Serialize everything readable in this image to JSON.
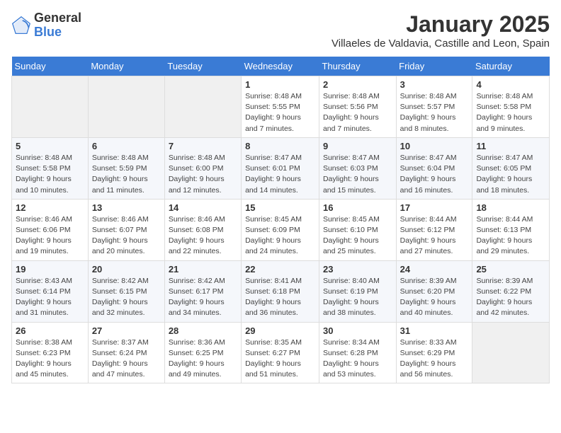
{
  "header": {
    "logo_general": "General",
    "logo_blue": "Blue",
    "month": "January 2025",
    "location": "Villaeles de Valdavia, Castille and Leon, Spain"
  },
  "weekdays": [
    "Sunday",
    "Monday",
    "Tuesday",
    "Wednesday",
    "Thursday",
    "Friday",
    "Saturday"
  ],
  "weeks": [
    [
      {
        "day": "",
        "info": ""
      },
      {
        "day": "",
        "info": ""
      },
      {
        "day": "",
        "info": ""
      },
      {
        "day": "1",
        "info": "Sunrise: 8:48 AM\nSunset: 5:55 PM\nDaylight: 9 hours and 7 minutes."
      },
      {
        "day": "2",
        "info": "Sunrise: 8:48 AM\nSunset: 5:56 PM\nDaylight: 9 hours and 7 minutes."
      },
      {
        "day": "3",
        "info": "Sunrise: 8:48 AM\nSunset: 5:57 PM\nDaylight: 9 hours and 8 minutes."
      },
      {
        "day": "4",
        "info": "Sunrise: 8:48 AM\nSunset: 5:58 PM\nDaylight: 9 hours and 9 minutes."
      }
    ],
    [
      {
        "day": "5",
        "info": "Sunrise: 8:48 AM\nSunset: 5:58 PM\nDaylight: 9 hours and 10 minutes."
      },
      {
        "day": "6",
        "info": "Sunrise: 8:48 AM\nSunset: 5:59 PM\nDaylight: 9 hours and 11 minutes."
      },
      {
        "day": "7",
        "info": "Sunrise: 8:48 AM\nSunset: 6:00 PM\nDaylight: 9 hours and 12 minutes."
      },
      {
        "day": "8",
        "info": "Sunrise: 8:47 AM\nSunset: 6:01 PM\nDaylight: 9 hours and 14 minutes."
      },
      {
        "day": "9",
        "info": "Sunrise: 8:47 AM\nSunset: 6:03 PM\nDaylight: 9 hours and 15 minutes."
      },
      {
        "day": "10",
        "info": "Sunrise: 8:47 AM\nSunset: 6:04 PM\nDaylight: 9 hours and 16 minutes."
      },
      {
        "day": "11",
        "info": "Sunrise: 8:47 AM\nSunset: 6:05 PM\nDaylight: 9 hours and 18 minutes."
      }
    ],
    [
      {
        "day": "12",
        "info": "Sunrise: 8:46 AM\nSunset: 6:06 PM\nDaylight: 9 hours and 19 minutes."
      },
      {
        "day": "13",
        "info": "Sunrise: 8:46 AM\nSunset: 6:07 PM\nDaylight: 9 hours and 20 minutes."
      },
      {
        "day": "14",
        "info": "Sunrise: 8:46 AM\nSunset: 6:08 PM\nDaylight: 9 hours and 22 minutes."
      },
      {
        "day": "15",
        "info": "Sunrise: 8:45 AM\nSunset: 6:09 PM\nDaylight: 9 hours and 24 minutes."
      },
      {
        "day": "16",
        "info": "Sunrise: 8:45 AM\nSunset: 6:10 PM\nDaylight: 9 hours and 25 minutes."
      },
      {
        "day": "17",
        "info": "Sunrise: 8:44 AM\nSunset: 6:12 PM\nDaylight: 9 hours and 27 minutes."
      },
      {
        "day": "18",
        "info": "Sunrise: 8:44 AM\nSunset: 6:13 PM\nDaylight: 9 hours and 29 minutes."
      }
    ],
    [
      {
        "day": "19",
        "info": "Sunrise: 8:43 AM\nSunset: 6:14 PM\nDaylight: 9 hours and 31 minutes."
      },
      {
        "day": "20",
        "info": "Sunrise: 8:42 AM\nSunset: 6:15 PM\nDaylight: 9 hours and 32 minutes."
      },
      {
        "day": "21",
        "info": "Sunrise: 8:42 AM\nSunset: 6:17 PM\nDaylight: 9 hours and 34 minutes."
      },
      {
        "day": "22",
        "info": "Sunrise: 8:41 AM\nSunset: 6:18 PM\nDaylight: 9 hours and 36 minutes."
      },
      {
        "day": "23",
        "info": "Sunrise: 8:40 AM\nSunset: 6:19 PM\nDaylight: 9 hours and 38 minutes."
      },
      {
        "day": "24",
        "info": "Sunrise: 8:39 AM\nSunset: 6:20 PM\nDaylight: 9 hours and 40 minutes."
      },
      {
        "day": "25",
        "info": "Sunrise: 8:39 AM\nSunset: 6:22 PM\nDaylight: 9 hours and 42 minutes."
      }
    ],
    [
      {
        "day": "26",
        "info": "Sunrise: 8:38 AM\nSunset: 6:23 PM\nDaylight: 9 hours and 45 minutes."
      },
      {
        "day": "27",
        "info": "Sunrise: 8:37 AM\nSunset: 6:24 PM\nDaylight: 9 hours and 47 minutes."
      },
      {
        "day": "28",
        "info": "Sunrise: 8:36 AM\nSunset: 6:25 PM\nDaylight: 9 hours and 49 minutes."
      },
      {
        "day": "29",
        "info": "Sunrise: 8:35 AM\nSunset: 6:27 PM\nDaylight: 9 hours and 51 minutes."
      },
      {
        "day": "30",
        "info": "Sunrise: 8:34 AM\nSunset: 6:28 PM\nDaylight: 9 hours and 53 minutes."
      },
      {
        "day": "31",
        "info": "Sunrise: 8:33 AM\nSunset: 6:29 PM\nDaylight: 9 hours and 56 minutes."
      },
      {
        "day": "",
        "info": ""
      }
    ]
  ]
}
